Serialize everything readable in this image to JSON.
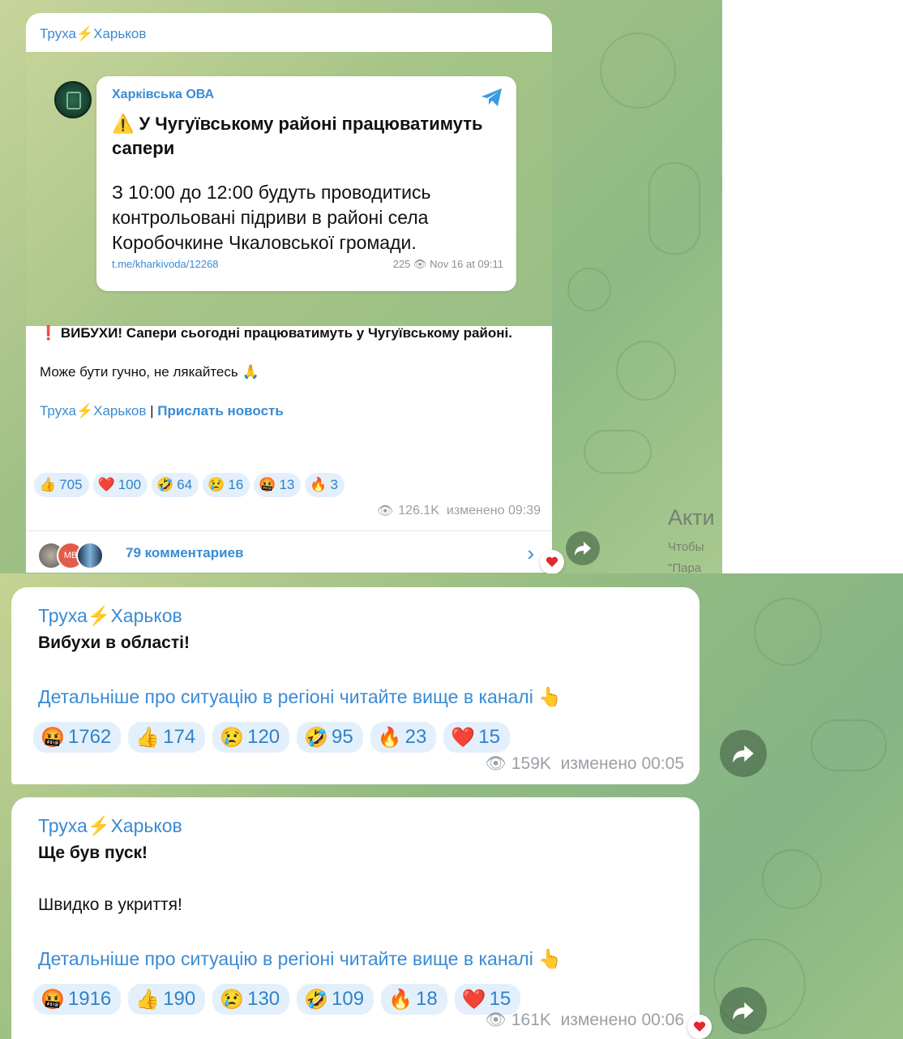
{
  "channel": {
    "name_part1": "Труха",
    "bolt": "⚡",
    "name_part2": "Харьков"
  },
  "post1": {
    "embed": {
      "source": "Харківська ОВА",
      "title": "⚠️ У Чугуївському районі працюватимуть сапери",
      "body": "З 10:00 до 12:00 будуть проводитись контрольовані підриви в районі села Коробочкине Чкаловської громади.",
      "link": "t.me/kharkivoda/12268",
      "views": "225",
      "date": "Nov 16 at 09:11"
    },
    "text_excl": "❗",
    "text_bold": "ВИБУХИ! Сапери сьогодні працюватимуть у Чугуївському районі.",
    "text_line2": "Може бути гучно, не лякайтесь 🙏",
    "signature_sep": "|",
    "signature_link": "Прислать новость",
    "reactions": [
      {
        "emoji": "👍",
        "count": "705"
      },
      {
        "emoji": "❤️",
        "count": "100"
      },
      {
        "emoji": "🤣",
        "count": "64"
      },
      {
        "emoji": "😢",
        "count": "16"
      },
      {
        "emoji": "🤬",
        "count": "13"
      },
      {
        "emoji": "🔥",
        "count": "3"
      }
    ],
    "views": "126.1K",
    "edited": "изменено 09:39",
    "comments": "79 комментариев",
    "commenter_initials": "MB"
  },
  "post2": {
    "title": "Вибухи в області!",
    "link_text": "Детальніше про ситуацію в регіоні читайте вище в каналі 👆",
    "reactions": [
      {
        "emoji": "🤬",
        "count": "1762"
      },
      {
        "emoji": "👍",
        "count": "174"
      },
      {
        "emoji": "😢",
        "count": "120"
      },
      {
        "emoji": "🤣",
        "count": "95"
      },
      {
        "emoji": "🔥",
        "count": "23"
      },
      {
        "emoji": "❤️",
        "count": "15"
      }
    ],
    "views": "159K",
    "edited": "изменено 00:05"
  },
  "post3": {
    "title": "Ще був пуск!",
    "line2": "Швидко в укриття!",
    "link_text": "Детальніше про ситуацію в регіоні читайте вище в каналі 👆",
    "reactions": [
      {
        "emoji": "🤬",
        "count": "1916"
      },
      {
        "emoji": "👍",
        "count": "190"
      },
      {
        "emoji": "😢",
        "count": "130"
      },
      {
        "emoji": "🤣",
        "count": "109"
      },
      {
        "emoji": "🔥",
        "count": "18"
      },
      {
        "emoji": "❤️",
        "count": "15"
      }
    ],
    "views": "161K",
    "edited": "изменено 00:06"
  },
  "side_text": {
    "line1": "Акти",
    "line2": "Чтобы",
    "line3": "\"Пара"
  },
  "icons": {
    "views": "eye-icon",
    "share": "share-arrow-icon",
    "telegram": "telegram-plane-icon",
    "chevron": "chevron-right-icon",
    "heart": "heart-reaction-icon"
  },
  "colors": {
    "link_blue": "#3a8bd4",
    "reaction_bg": "#e3f0fb",
    "meta_gray": "#9aa0a6"
  }
}
